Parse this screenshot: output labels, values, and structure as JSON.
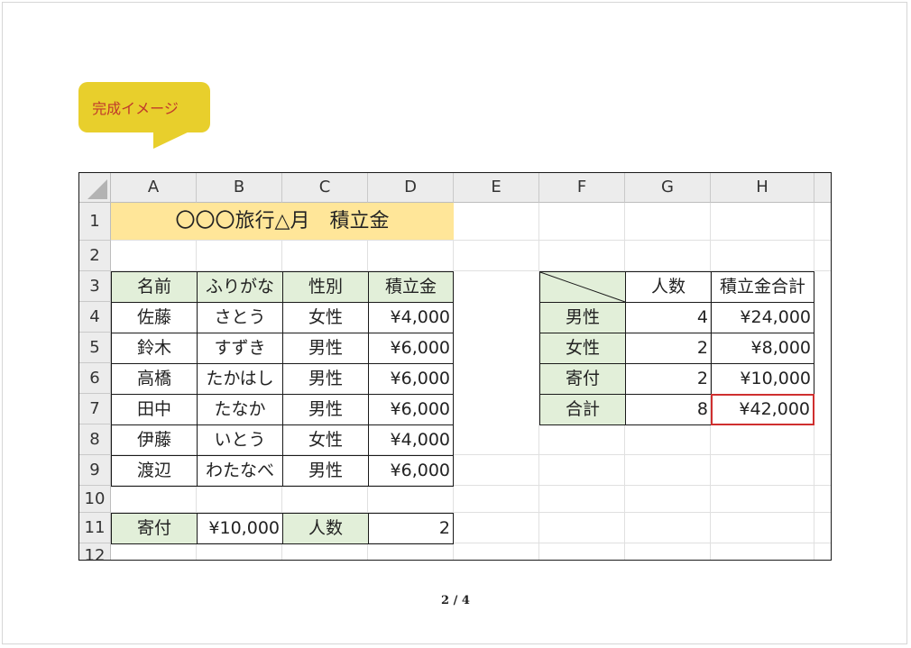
{
  "callout": {
    "label": "完成イメージ"
  },
  "spreadsheet": {
    "column_headers": [
      "A",
      "B",
      "C",
      "D",
      "E",
      "F",
      "G",
      "H"
    ],
    "row_headers": [
      "1",
      "2",
      "3",
      "4",
      "5",
      "6",
      "7",
      "8",
      "9",
      "10",
      "11",
      "12"
    ],
    "title": "〇〇〇旅行△月　積立金",
    "member_table": {
      "headers": [
        "名前",
        "ふりがな",
        "性別",
        "積立金"
      ],
      "rows": [
        [
          "佐藤",
          "さとう",
          "女性",
          "¥4,000"
        ],
        [
          "鈴木",
          "すずき",
          "男性",
          "¥6,000"
        ],
        [
          "高橋",
          "たかはし",
          "男性",
          "¥6,000"
        ],
        [
          "田中",
          "たなか",
          "男性",
          "¥6,000"
        ],
        [
          "伊藤",
          "いとう",
          "女性",
          "¥4,000"
        ],
        [
          "渡辺",
          "わたなべ",
          "男性",
          "¥6,000"
        ]
      ]
    },
    "donation_row": {
      "label": "寄付",
      "amount": "¥10,000",
      "count_label": "人数",
      "count": "2"
    },
    "summary_table": {
      "headers": [
        "",
        "人数",
        "積立金合計"
      ],
      "rows": [
        [
          "男性",
          "4",
          "¥24,000"
        ],
        [
          "女性",
          "2",
          "¥8,000"
        ],
        [
          "寄付",
          "2",
          "¥10,000"
        ],
        [
          "合計",
          "8",
          "¥42,000"
        ]
      ]
    },
    "colors": {
      "title_fill": "#ffe699",
      "label_fill": "#e2efd9",
      "highlight_border": "#cf2f2f"
    }
  },
  "page_indicator": "2 / 4"
}
